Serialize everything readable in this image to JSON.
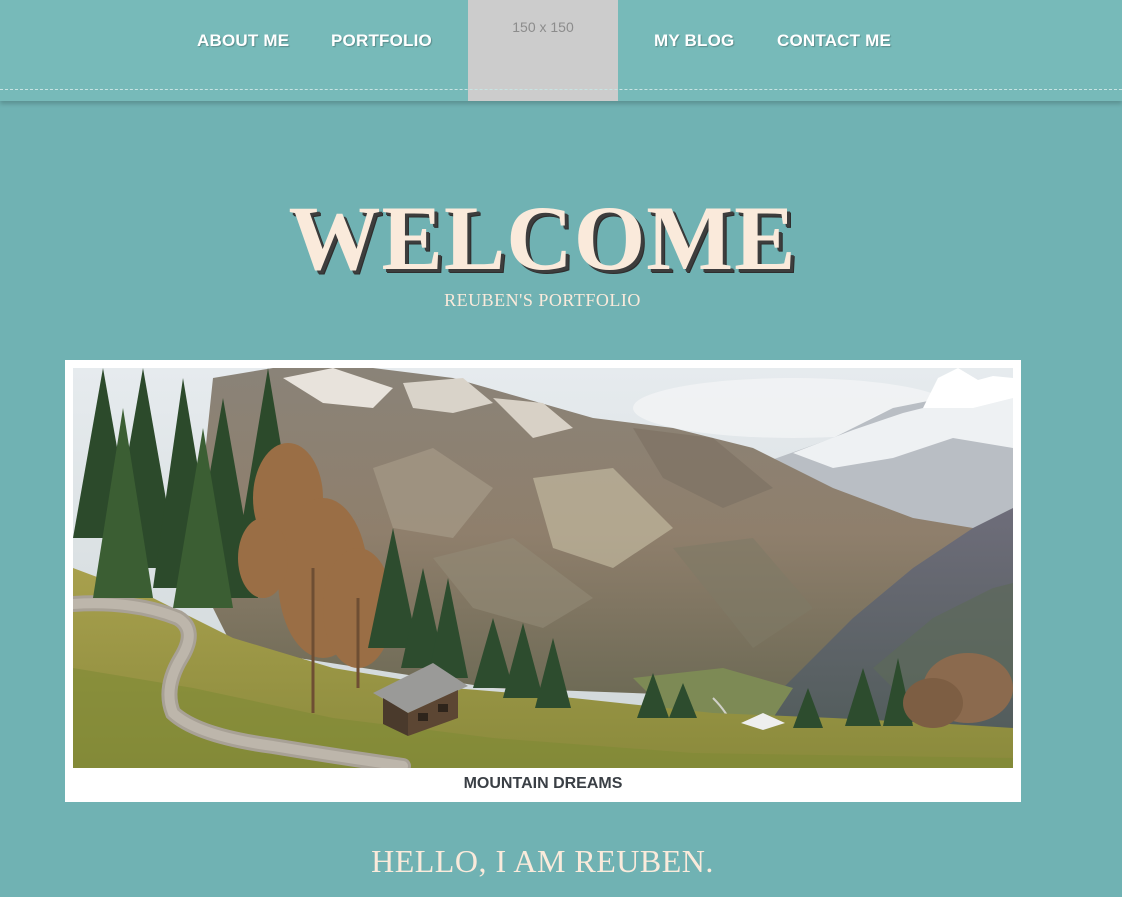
{
  "nav": {
    "items": [
      {
        "label": "ABOUT ME"
      },
      {
        "label": "PORTFOLIO"
      },
      {
        "label": "MY BLOG"
      },
      {
        "label": "CONTACT ME"
      }
    ],
    "logo_placeholder": "150 x 150"
  },
  "hero": {
    "title": "WELCOME",
    "subtitle": "REUBEN'S PORTFOLIO"
  },
  "figure": {
    "caption": "MOUNTAIN DREAMS"
  },
  "intro": {
    "heading": "HELLO, I AM REUBEN."
  },
  "colors": {
    "page_background": "#70b2b3",
    "nav_background": "#77bab9",
    "title_text": "#faeadb",
    "placeholder": "#cccccc"
  }
}
